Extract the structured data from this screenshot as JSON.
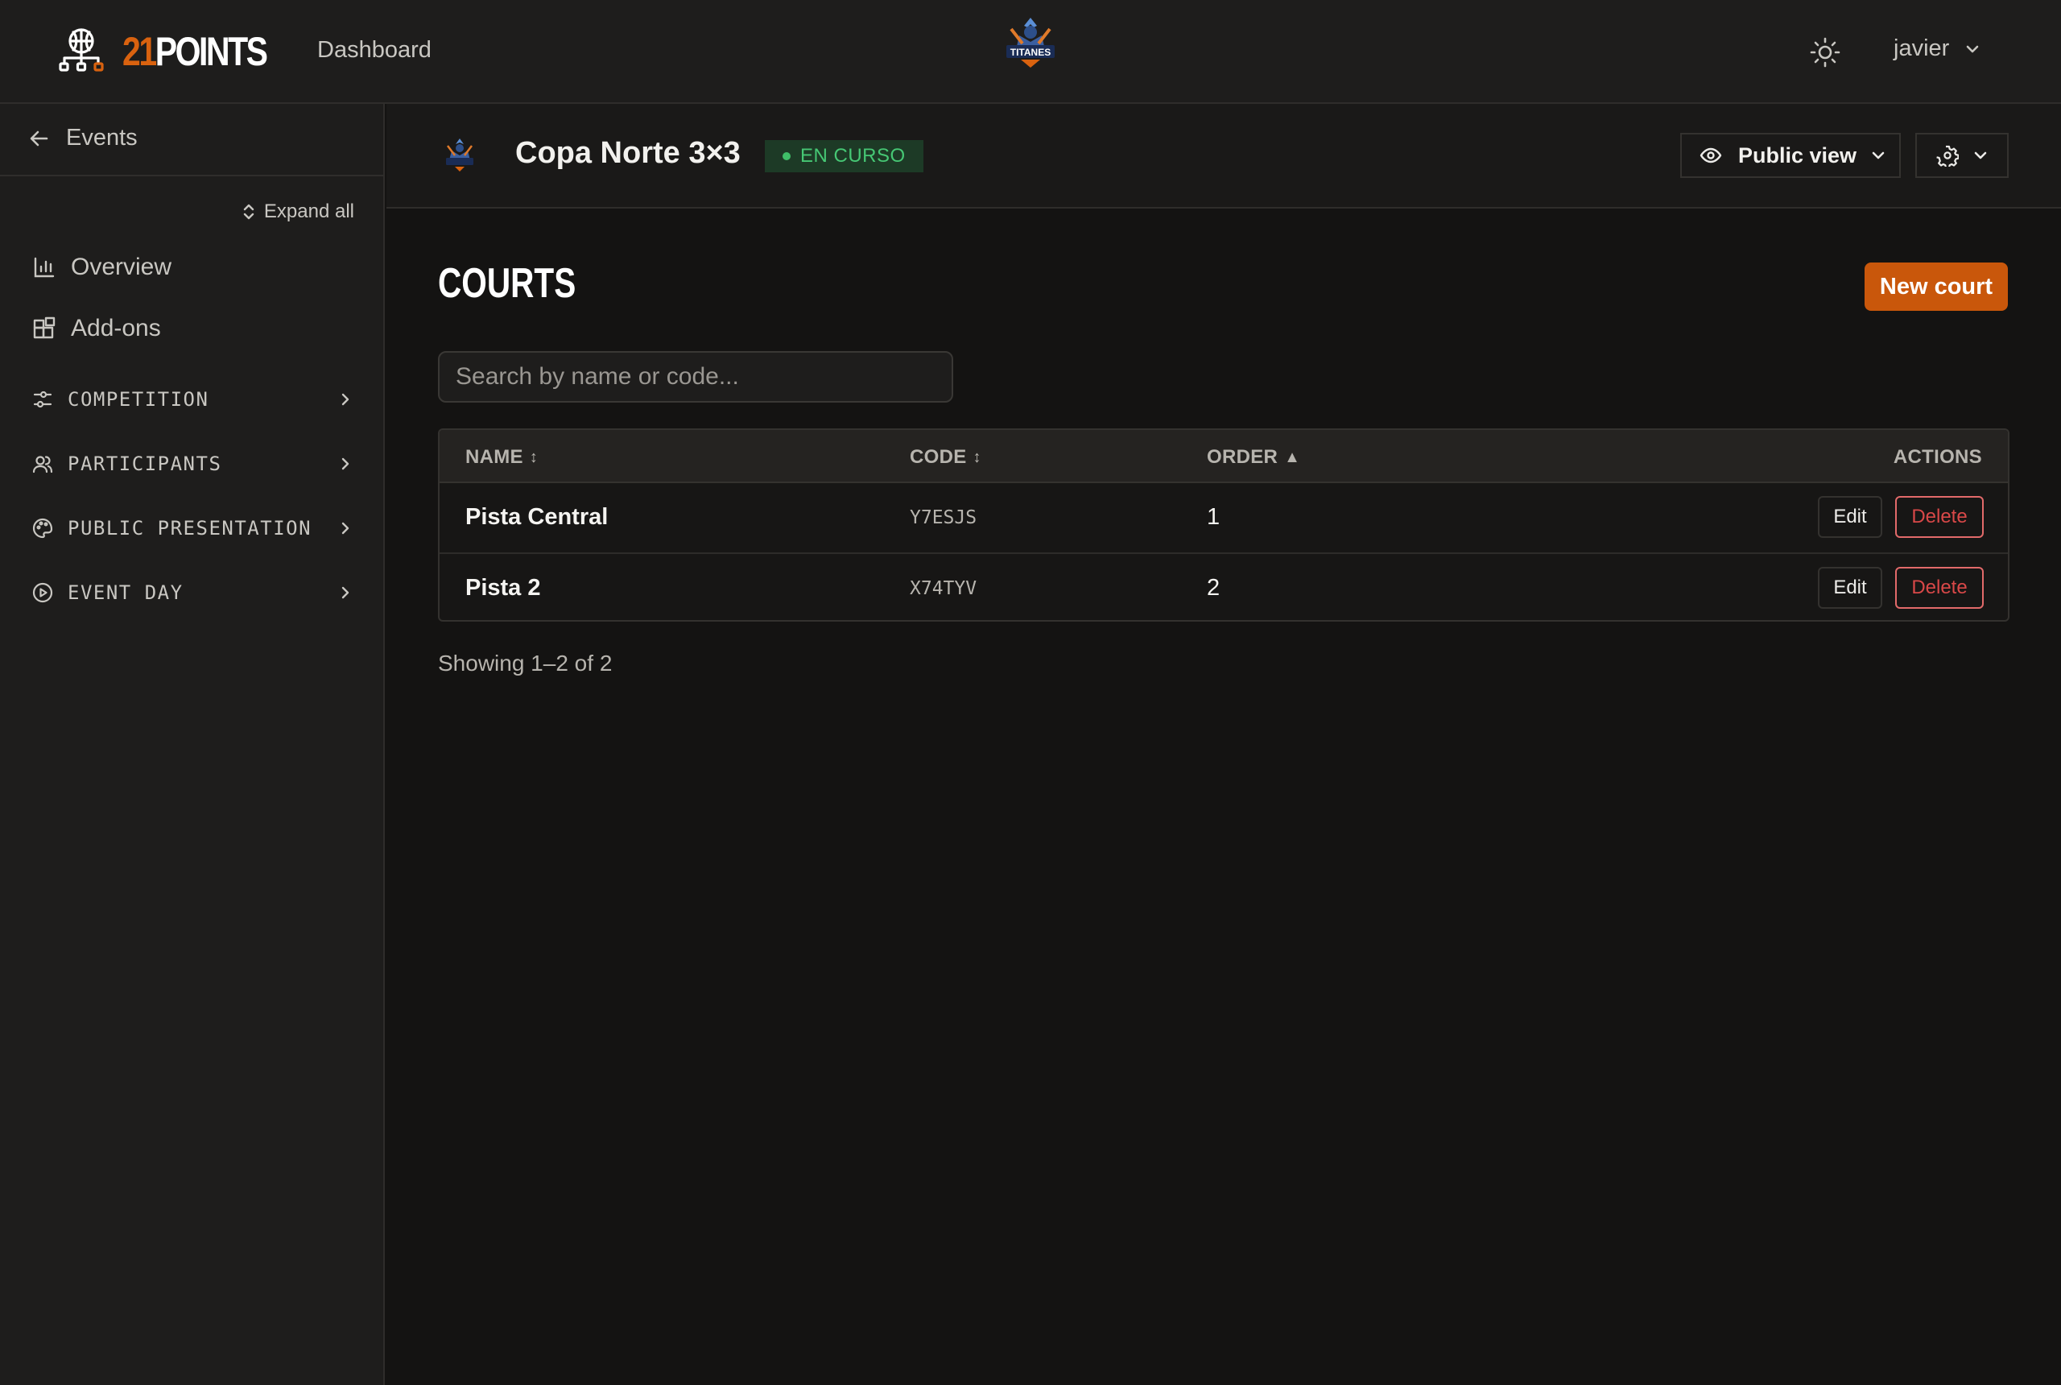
{
  "topbar": {
    "brand_number": "21",
    "brand_word": "POINTS",
    "nav_dashboard": "Dashboard",
    "club_logo_text": "TITANES",
    "user_name": "javier",
    "icons": [
      "court-icon",
      "club-logo",
      "sun-icon",
      "chevron-down-icon"
    ]
  },
  "sidebar": {
    "back_label": "Events",
    "expand_all": "Expand all",
    "links": [
      {
        "label": "Overview",
        "icon": "bar-chart-icon"
      },
      {
        "label": "Add-ons",
        "icon": "blocks-icon"
      }
    ],
    "sections": [
      {
        "label": "COMPETITION",
        "icon": "sliders-icon"
      },
      {
        "label": "PARTICIPANTS",
        "icon": "users-icon"
      },
      {
        "label": "PUBLIC PRESENTATION",
        "icon": "palette-icon"
      },
      {
        "label": "EVENT DAY",
        "icon": "play-circle-icon"
      }
    ]
  },
  "header": {
    "event_title": "Copa Norte 3×3",
    "status": "EN CURSO",
    "public_view": "Public view"
  },
  "main": {
    "title": "COURTS",
    "new_button": "New court",
    "search_placeholder": "Search by name or code...",
    "table": {
      "headers": {
        "name": "NAME",
        "name_sort": "↕",
        "code": "CODE",
        "code_sort": "↕",
        "order": "ORDER",
        "order_sort": "▲",
        "actions": "ACTIONS"
      },
      "rows": [
        {
          "name": "Pista Central",
          "code": "Y7ESJS",
          "order": "1",
          "edit": "Edit",
          "delete": "Delete"
        },
        {
          "name": "Pista 2",
          "code": "X74TYV",
          "order": "2",
          "edit": "Edit",
          "delete": "Delete"
        }
      ]
    },
    "pagination": "Showing 1–2 of 2"
  },
  "colors": {
    "accent": "#c9570b",
    "brand_orange": "#d9620f",
    "status_green": "#46c774",
    "danger": "#d94848",
    "background": "#141312",
    "panel": "#1e1d1c"
  }
}
